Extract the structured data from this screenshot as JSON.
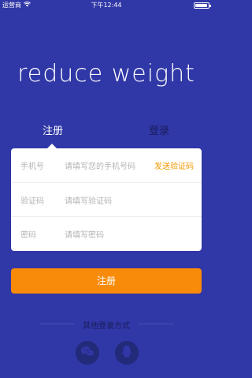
{
  "status_bar": {
    "carrier": "运营商",
    "time": "下午12:44"
  },
  "app": {
    "title": "reduce weight"
  },
  "tabs": [
    {
      "label": "注册"
    },
    {
      "label": "登录"
    }
  ],
  "form": {
    "phone": {
      "label": "手机号",
      "placeholder": "请填写您的手机号码",
      "action": "发送验证码"
    },
    "code": {
      "label": "验证码",
      "placeholder": "请填写验证码"
    },
    "password": {
      "label": "密码",
      "placeholder": "请填写密码"
    }
  },
  "submit_label": "注册",
  "other_login": {
    "label": "其他登录方式",
    "methods": [
      {
        "icon": "wechat-icon"
      },
      {
        "icon": "qq-icon"
      }
    ]
  },
  "colors": {
    "background": "#3037a6",
    "accent": "#f98b0a",
    "link": "#f39800"
  }
}
